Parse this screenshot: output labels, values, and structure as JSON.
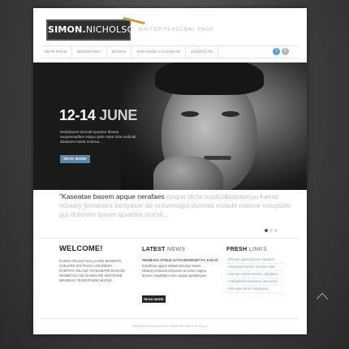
{
  "header": {
    "logo_bold": "SIMON.",
    "logo_light": "NICHOLSON",
    "tagline": "WRITER PERSONAL PAGE"
  },
  "nav": {
    "items": [
      "MAIN PAGE",
      "BIOGRAPHY",
      "BOOKS",
      "SPEAKING CALENDAR",
      "CONTACTS"
    ]
  },
  "social": {
    "twitter_glyph": "t",
    "facebook_glyph": "f"
  },
  "hero": {
    "date": "12-14",
    "month": "JUNE",
    "text": "Nerbylaues tnercatl quuntee lbeasa aoquesnadties esqua quite sepa dota sudicab abaetues baset nostrua...",
    "button": "READ MORE"
  },
  "quote": {
    "dark": "\"Kaseatae basem apque nerafaes",
    "light": "epque dicta suplicabobasetyu kaeas etbasry jertaesira kertyaser as unturmagni,dolores euiade ratione voluptate qui dolorem ipsum quiades olorsit..."
  },
  "slider": {
    "dots": 3,
    "active": 1
  },
  "welcome": {
    "title": "WELCOME!",
    "text": "PUSCE FELGIAT MALLAORE BEHDETR OVBLERE NIS FEUGI LORAIBERA KAERTAS YELASE AS NESBARE DASAGE NRSBETAS ASE DANESARE SERTSSRE MRSBEAS TESDEFEMSE MURSE."
  },
  "news": {
    "title_dark": "LATEST",
    "title_light": "NEWS",
    "headline": "NEMBAES APQUE DATAABORBSETYU KAEAS",
    "text": "Estsdbrua apque dataaborbsetyu kaeas etbasry jertaesira kertyaser as untur magna dolores eaadedtes enim aeque gestaltiques",
    "button": "READ MORE"
  },
  "links": {
    "title_dark": "FRESH",
    "title_light": "LINKS",
    "items": [
      "Elesaer qunta doloree kasaters",
      "Uitanteshe aelurs reseras etiam",
      "Inarmes sretae aeterse nasdgerer",
      "Ivasilastesla sarslaesa aeteaeras",
      "Mmeaaet terser nasdareas"
    ]
  },
  "footer": {
    "text": "SIMON.NICHOLSON © 2013 PRIVACY POLICY"
  }
}
